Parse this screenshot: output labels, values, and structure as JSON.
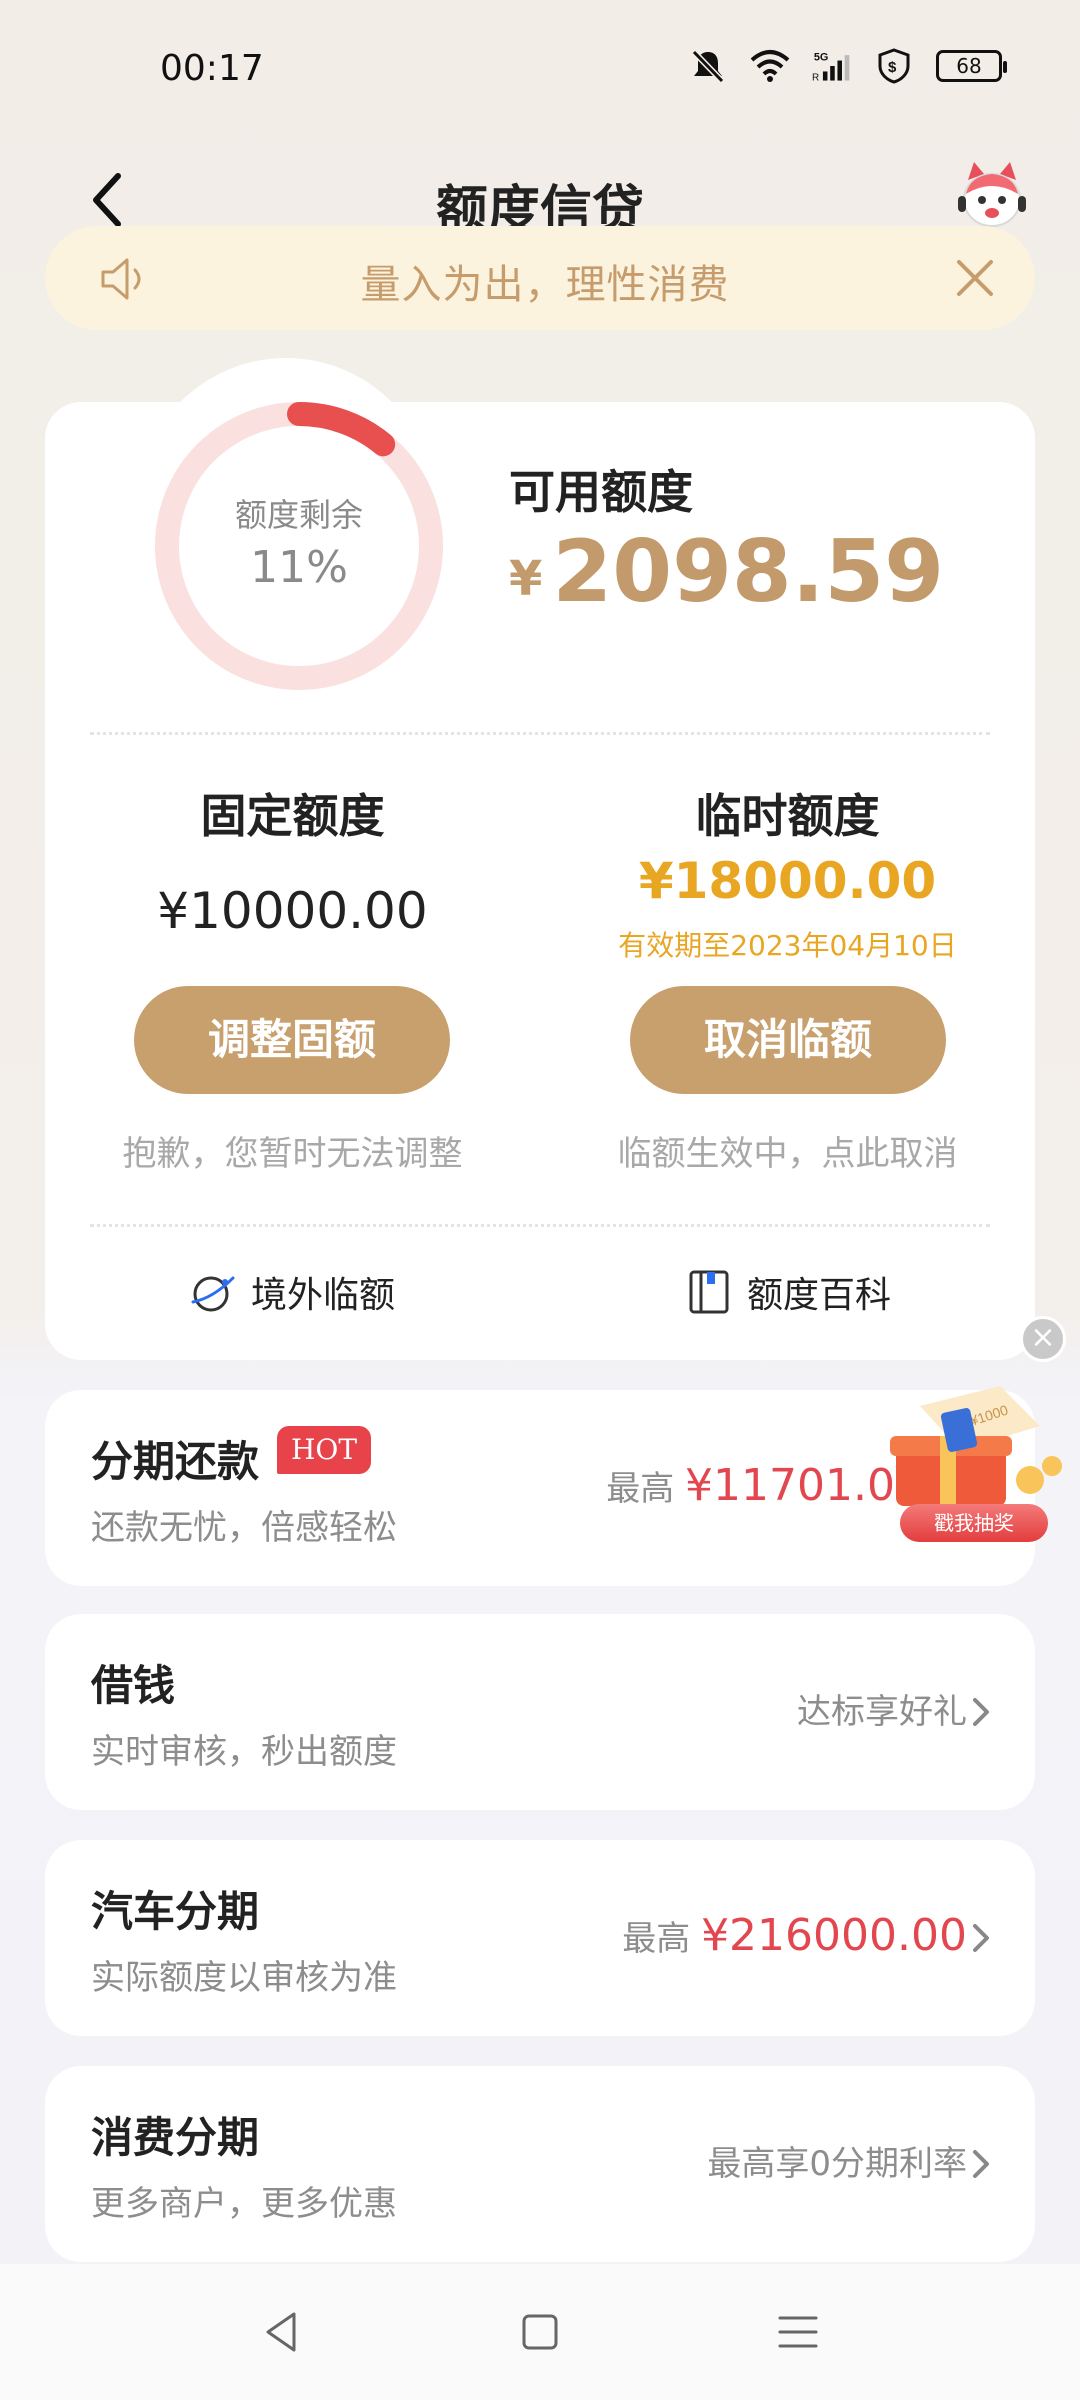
{
  "status_bar": {
    "time": "00:17",
    "battery": "68"
  },
  "header": {
    "title": "额度信贷"
  },
  "notice": {
    "text": "量入为出，理性消费"
  },
  "credit": {
    "ring_label": "额度剩余",
    "ring_percent": "11%",
    "ring_fraction": 0.11,
    "available_label": "可用额度",
    "available_currency": "¥",
    "available_amount": "2098.59",
    "fixed_title": "固定额度",
    "fixed_amount": "¥10000.00",
    "fixed_button": "调整固额",
    "fixed_note": "抱歉，您暂时无法调整",
    "temp_title": "临时额度",
    "temp_amount": "¥18000.00",
    "temp_valid": "有效期至2023年04月10日",
    "temp_button": "取消临额",
    "temp_note": "临额生效中，点此取消",
    "link_overseas": "境外临额",
    "link_wiki": "额度百科"
  },
  "promo": {
    "button": "戳我抽奖",
    "badge_value": "¥1000"
  },
  "services": [
    {
      "title": "分期还款",
      "badge": "HOT",
      "subtitle": "还款无忧，倍感轻松",
      "right_prefix": "最高",
      "right_amount": "¥11701.0"
    },
    {
      "title": "借钱",
      "subtitle": "实时审核，秒出额度",
      "right_text": "达标享好礼"
    },
    {
      "title": "汽车分期",
      "subtitle": "实际额度以审核为准",
      "right_prefix": "最高",
      "right_amount": "¥216000.00"
    },
    {
      "title": "消费分期",
      "subtitle": "更多商户，更多优惠",
      "right_text": "最高享0分期利率"
    }
  ],
  "colors": {
    "gold": "#c8a06e",
    "orange": "#e9a623",
    "red": "#e2474f",
    "ring_track": "#fbe0e0",
    "ring_fill": "#e85050"
  }
}
